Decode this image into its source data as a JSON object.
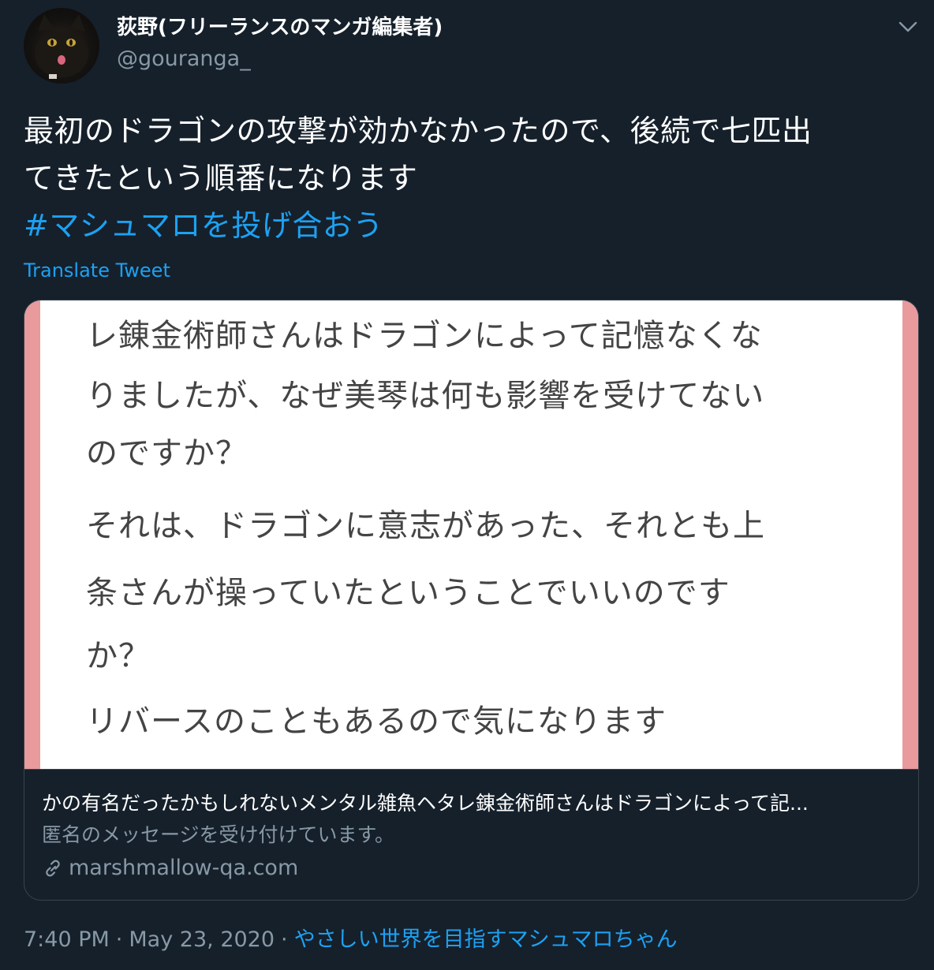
{
  "author": {
    "display_name": "荻野(フリーランスのマンガ編集者)",
    "handle": "@gouranga_"
  },
  "tweet": {
    "text_lines": [
      "最初のドラゴンの攻撃が効かなかったので、後続で七匹出",
      "てきたという順番になります"
    ],
    "hashtag": "#マシュマロを投げ合おう",
    "translate_label": "Translate Tweet"
  },
  "card": {
    "image_question_lines": [
      "レ錬金術師さんはドラゴンによって記憶なくな",
      "りましたが、なぜ美琴は何も影響を受けてない",
      "のですか？",
      "それは、ドラゴンに意志があった、それとも上",
      "条さんが操っていたということでいいのです",
      "か？",
      "リバースのこともあるので気になります"
    ],
    "title": "かの有名だったかもしれないメンタル雑魚ヘタレ錬金術師さんはドラゴンによって記...",
    "description": "匿名のメッセージを受け付けています。",
    "domain": "marshmallow-qa.com",
    "accent_color": "#e89a9c"
  },
  "meta": {
    "time": "7:40 PM",
    "date": "May 23, 2020",
    "separator": "·",
    "source": "やさしい世界を目指すマシュマロちゃん"
  },
  "icons": {
    "avatar": "cat-avatar",
    "menu": "chevron-down-icon",
    "link": "link-icon"
  },
  "colors": {
    "background": "#15202b",
    "link": "#1da1f2",
    "secondary_text": "#8899a6",
    "border": "#38444d"
  }
}
